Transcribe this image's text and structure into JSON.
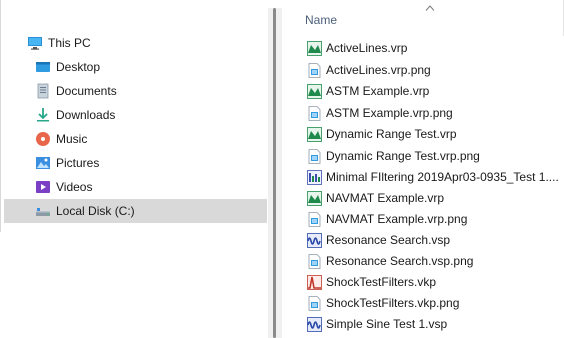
{
  "nav": {
    "items": [
      {
        "label": "This PC",
        "icon": "computer-icon"
      },
      {
        "label": "Desktop",
        "icon": "desktop-folder-icon"
      },
      {
        "label": "Documents",
        "icon": "documents-icon"
      },
      {
        "label": "Downloads",
        "icon": "downloads-icon"
      },
      {
        "label": "Music",
        "icon": "music-icon"
      },
      {
        "label": "Pictures",
        "icon": "pictures-icon"
      },
      {
        "label": "Videos",
        "icon": "videos-icon"
      },
      {
        "label": "Local Disk (C:)",
        "icon": "local-disk-icon",
        "selected": true
      }
    ]
  },
  "files": {
    "column_name": "Name",
    "sort": "ascending",
    "items": [
      {
        "name": "ActiveLines.vrp",
        "icon": "vrp-file-icon"
      },
      {
        "name": "ActiveLines.vrp.png",
        "icon": "png-file-icon"
      },
      {
        "name": "ASTM Example.vrp",
        "icon": "vrp-file-icon"
      },
      {
        "name": "ASTM Example.vrp.png",
        "icon": "png-file-icon"
      },
      {
        "name": "Dynamic Range Test.vrp",
        "icon": "vrp-file-icon"
      },
      {
        "name": "Dynamic Range Test.vrp.png",
        "icon": "png-file-icon"
      },
      {
        "name": "Minimal FIltering 2019Apr03-0935_Test 1....",
        "icon": "data-file-icon"
      },
      {
        "name": "NAVMAT Example.vrp",
        "icon": "vrp-file-icon"
      },
      {
        "name": "NAVMAT Example.vrp.png",
        "icon": "png-file-icon"
      },
      {
        "name": "Resonance Search.vsp",
        "icon": "vsp-file-icon"
      },
      {
        "name": "Resonance Search.vsp.png",
        "icon": "png-file-icon"
      },
      {
        "name": "ShockTestFilters.vkp",
        "icon": "vkp-file-icon"
      },
      {
        "name": "ShockTestFilters.vkp.png",
        "icon": "png-file-icon"
      },
      {
        "name": "Simple Sine Test 1.vsp",
        "icon": "vsp-file-icon"
      }
    ]
  },
  "colors": {
    "selected_bg": "#d9d9d9",
    "header_text": "#4c607a",
    "vrp_green": "#1f8a4c",
    "vsp_blue": "#2a4aa8",
    "vkp_red": "#c0392b"
  }
}
